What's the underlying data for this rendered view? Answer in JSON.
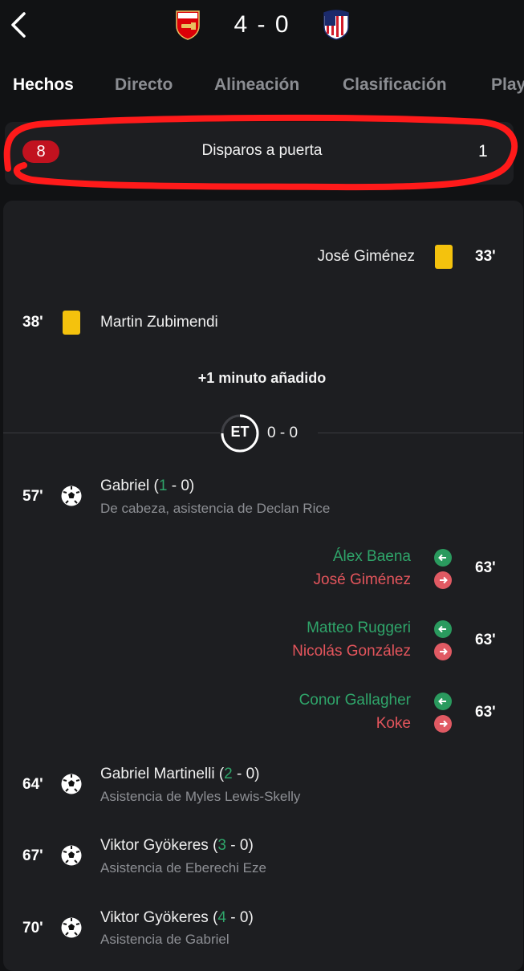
{
  "header": {
    "back_icon": "chevron-left-icon",
    "home_crest": "arsenal-crest",
    "away_crest": "atletico-crest",
    "score": "4 - 0"
  },
  "tabs": [
    {
      "label": "Hechos",
      "active": true
    },
    {
      "label": "Directo"
    },
    {
      "label": "Alineación"
    },
    {
      "label": "Clasificación"
    },
    {
      "label": "Play"
    }
  ],
  "stat": {
    "home": "8",
    "label": "Disparos a puerta",
    "away": "1"
  },
  "colors": {
    "yellow_card": "#f4c20d",
    "sub_in": "#2fa56a",
    "sub_out": "#e4555c",
    "highlight": "#ff1a1a"
  },
  "events": {
    "gimenez_card": {
      "name": "José Giménez",
      "minute": "33'"
    },
    "zubimendi_card": {
      "minute": "38'",
      "name": "Martin Zubimendi"
    },
    "added_time": "+1 minuto añadido",
    "et": {
      "badge": "ET",
      "score": "0 - 0"
    },
    "goal1": {
      "minute": "57'",
      "scorer": "Gabriel",
      "score_home": "1",
      "score_rest": " - 0)",
      "detail": "De cabeza, asistencia de Declan Rice"
    },
    "sub1": {
      "in": "Álex Baena",
      "out": "José Giménez",
      "minute": "63'"
    },
    "sub2": {
      "in": "Matteo Ruggeri",
      "out": "Nicolás González",
      "minute": "63'"
    },
    "sub3": {
      "in": "Conor Gallagher",
      "out": "Koke",
      "minute": "63'"
    },
    "goal2": {
      "minute": "64'",
      "scorer": "Gabriel Martinelli",
      "score_home": "2",
      "score_rest": " - 0)",
      "detail": "Asistencia de Myles Lewis-Skelly"
    },
    "goal3": {
      "minute": "67'",
      "scorer": "Viktor Gyökeres",
      "score_home": "3",
      "score_rest": " - 0)",
      "detail": "Asistencia de Eberechi Eze"
    },
    "goal4": {
      "minute": "70'",
      "scorer": "Viktor Gyökeres",
      "score_home": "4",
      "score_rest": " - 0)",
      "detail": "Asistencia de Gabriel"
    }
  }
}
